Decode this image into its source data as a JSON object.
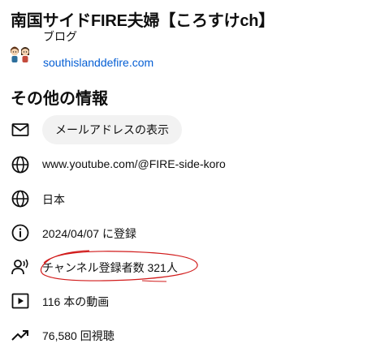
{
  "channel": {
    "title": "南国サイドFIRE夫婦【ころすけch】"
  },
  "link": {
    "label": "ブログ",
    "url": "southislanddefire.com",
    "avatar_icon": "couple-avatar-icon"
  },
  "other_info": {
    "title": "その他の情報",
    "email_button_label": "メールアドレスの表示",
    "website": "www.youtube.com/@FIRE-side-koro",
    "country": "日本",
    "joined": "2024/04/07 に登録",
    "subscribers": "チャンネル登録者数 321人",
    "videos": "116 本の動画",
    "views": "76,580 回視聴"
  },
  "icons": {
    "email": "mail-icon",
    "website": "globe-icon",
    "country": "globe-icon",
    "joined": "info-icon",
    "subscribers": "subscribers-icon",
    "videos": "video-icon",
    "views": "trending-icon"
  },
  "colors": {
    "link": "#065fd4",
    "button_bg": "#f2f2f2",
    "annotation": "#d11a1a"
  }
}
